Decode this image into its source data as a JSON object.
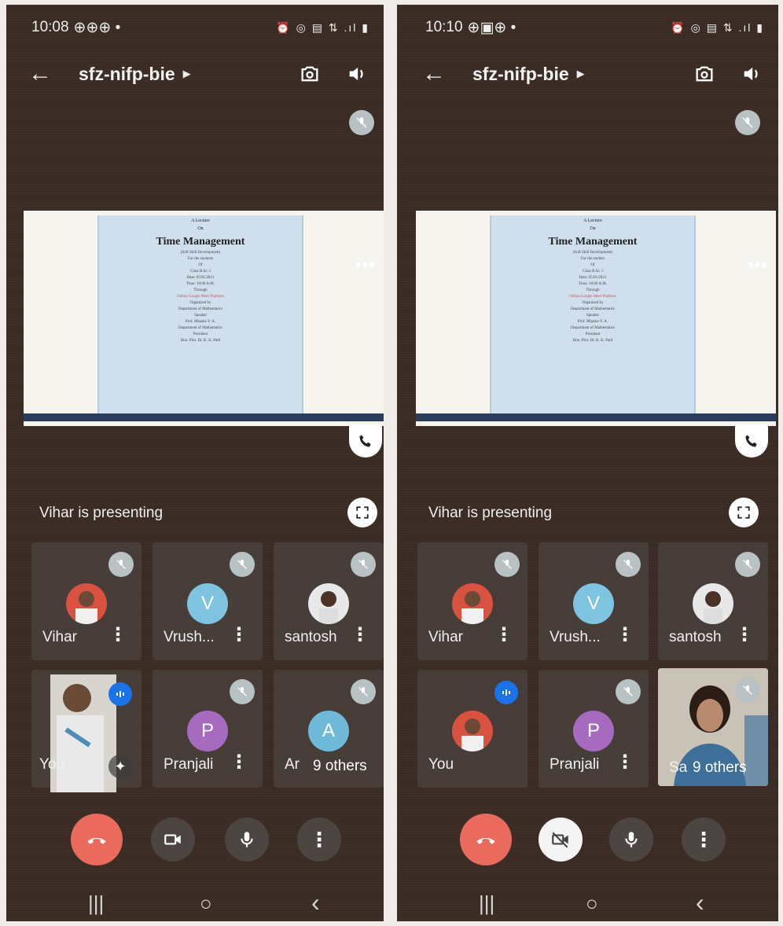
{
  "screens": [
    {
      "status": {
        "time": "10:08",
        "icons": "⊕⊕⊕ •",
        "right_icons": "⏰ ◎ ▤ ⇅ .ıl ▮"
      },
      "meeting_code": "sfz-nifp-bie",
      "presenting_label": "Vihar is presenting",
      "slide": {
        "line1": "A Lecture",
        "line2": "On",
        "title": "Time Management",
        "line4": "(Soft Skill Development)",
        "line5": "For the students",
        "line6": "Of",
        "line7": "Class B.Sc. I",
        "line8": "Date: 05/01/2021",
        "line9": "Time: 10:00 A.M.",
        "line10": "Through",
        "line11": "Online Google Meet Platform",
        "line12": "Organized by",
        "line13": "Department of Mathematics",
        "line14": "Speaker",
        "line15": "Prof. Mhaske V. A.",
        "line16": "Department of Mathematics",
        "line17": "President",
        "line18": "Hon. Prin. Dr. K. K. Patil"
      },
      "participants": [
        {
          "name": "Vihar",
          "initial": "",
          "color": "#d9523f"
        },
        {
          "name": "Vrush...",
          "initial": "V",
          "color": "#7ec4e0"
        },
        {
          "name": "santosh",
          "initial": "",
          "color": "#e8e8e8"
        },
        {
          "name": "You",
          "initial": "",
          "color": "#cfcfcf"
        },
        {
          "name": "Pranjali",
          "initial": "P",
          "color": "#a66bbe"
        },
        {
          "name": "Ar",
          "initial": "A",
          "color": "#6fb9d8"
        }
      ],
      "others_label": "9 others"
    },
    {
      "status": {
        "time": "10:10",
        "icons": "⊕▣⊕ •",
        "right_icons": "⏰ ◎ ▤ ⇅ .ıl ▮"
      },
      "meeting_code": "sfz-nifp-bie",
      "presenting_label": "Vihar is presenting",
      "slide": {
        "line1": "A Lecture",
        "line2": "On",
        "title": "Time Management",
        "line4": "(Soft Skill Development)",
        "line5": "For the student",
        "line6": "Of",
        "line7": "Class B.Sc. I",
        "line8": "Date: 05/01/2021",
        "line9": "Time: 10:00 A.M.",
        "line10": "Through",
        "line11": "Online Google Meet Platform",
        "line12": "Organized by",
        "line13": "Department of Mathematics",
        "line14": "Speaker",
        "line15": "Prof. Mhaske V. A.",
        "line16": "Department of Mathematics",
        "line17": "President",
        "line18": "Hon. Prin. Dr. K. K. Patil"
      },
      "participants": [
        {
          "name": "Vihar",
          "initial": "",
          "color": "#d9523f"
        },
        {
          "name": "Vrush...",
          "initial": "V",
          "color": "#7ec4e0"
        },
        {
          "name": "santosh",
          "initial": "",
          "color": "#e8e8e8"
        },
        {
          "name": "You",
          "initial": "",
          "color": "#d9523f"
        },
        {
          "name": "Pranjali",
          "initial": "P",
          "color": "#a66bbe"
        },
        {
          "name": "Sa",
          "initial": "",
          "color": "#8aa0b0"
        }
      ],
      "others_label": "9 others"
    }
  ],
  "colors": {
    "end_call": "#ea6b5d",
    "speaking": "#1a73e8",
    "mute_bubble": "#b8c1c4"
  },
  "icons": {
    "back": "arrow-left-icon",
    "switch_camera": "switch-camera-icon",
    "speaker": "speaker-icon",
    "mic_off": "mic-off-icon",
    "phone": "phone-icon",
    "fullscreen": "fullscreen-icon",
    "more": "more-vert-icon",
    "end_call": "call-end-icon",
    "camera": "camera-icon",
    "camera_off": "camera-off-icon",
    "mic": "mic-icon",
    "effects": "sparkle-icon"
  },
  "nav": {
    "recents": "|||",
    "home": "○",
    "back": "‹"
  }
}
